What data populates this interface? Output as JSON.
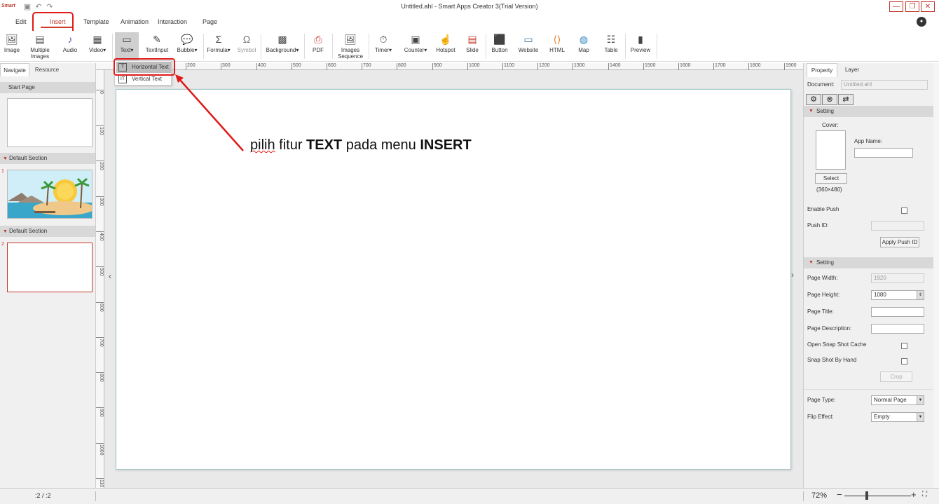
{
  "window": {
    "logo": "Smart",
    "title": "Untitled.ahl - Smart Apps Creator 3(Trial Version)",
    "minimize": "—",
    "maximize": "❐",
    "close": "✕"
  },
  "menu": {
    "tabs": [
      "Edit",
      "Insert",
      "Template",
      "Animation",
      "Interaction",
      "Page"
    ],
    "active": "Insert"
  },
  "ribbon": {
    "tools": [
      {
        "label": "Image",
        "icon": "image-icon"
      },
      {
        "label": "Multiple Images",
        "icon": "multiple-images-icon"
      },
      {
        "label": "Audio",
        "icon": "audio-icon"
      },
      {
        "label": "Video▾",
        "icon": "video-icon"
      },
      {
        "label": "Text▾",
        "icon": "text-icon"
      },
      {
        "label": "TextInput",
        "icon": "textinput-icon"
      },
      {
        "label": "Bubble▾",
        "icon": "bubble-icon"
      },
      {
        "label": "Formula▾",
        "icon": "formula-icon"
      },
      {
        "label": "Symbol",
        "icon": "symbol-icon"
      },
      {
        "label": "Background▾",
        "icon": "background-icon"
      },
      {
        "label": "PDF",
        "icon": "pdf-icon"
      },
      {
        "label": "Images Sequence",
        "icon": "images-sequence-icon"
      },
      {
        "label": "Timer▾",
        "icon": "timer-icon"
      },
      {
        "label": "Counter▾",
        "icon": "counter-icon"
      },
      {
        "label": "Hotspot",
        "icon": "hotspot-icon"
      },
      {
        "label": "Slide",
        "icon": "slide-icon"
      },
      {
        "label": "Button",
        "icon": "button-icon"
      },
      {
        "label": "Website",
        "icon": "website-icon"
      },
      {
        "label": "HTML",
        "icon": "html-icon"
      },
      {
        "label": "Map",
        "icon": "map-icon"
      },
      {
        "label": "Table",
        "icon": "table-icon"
      },
      {
        "label": "Preview",
        "icon": "preview-icon"
      }
    ],
    "text_dropdown": {
      "horizontal": "Horizontal Text",
      "vertical": "Vertical Text"
    }
  },
  "left_panel": {
    "tabs": [
      "Navigate",
      "Resource"
    ],
    "start_page": "Start Page",
    "sections": [
      {
        "title": "Default Section",
        "page_number": "1"
      },
      {
        "title": "Default Section",
        "page_number": "2"
      }
    ]
  },
  "ruler": {
    "top": [
      "200",
      "300",
      "400",
      "500",
      "600",
      "700",
      "800",
      "900",
      "1000",
      "1100",
      "1200",
      "1300",
      "1400",
      "1500",
      "1600",
      "1700",
      "1800",
      "1900"
    ],
    "left": [
      "0",
      "100",
      "200",
      "300",
      "400",
      "500",
      "600",
      "700",
      "800",
      "900",
      "1000",
      "110"
    ]
  },
  "annotation": {
    "part1": "pilih",
    "part2": " fitur ",
    "part3": "TEXT",
    "part4": " pada menu ",
    "part5": "INSERT"
  },
  "right_panel": {
    "tabs": [
      "Property",
      "Layer"
    ],
    "document_label": "Document:",
    "document_value": "Untitled.ahl",
    "section1": "Setting",
    "cover_label": "Cover:",
    "app_name_label": "App Name:",
    "select_button": "Select",
    "cover_size": "(360×480)",
    "enable_push": "Enable Push",
    "push_id": "Push ID:",
    "apply_push_id": "Apply Push ID",
    "section2": "Setting",
    "page_width_label": "Page Width:",
    "page_width": "1920",
    "page_height_label": "Page Height:",
    "page_height": "1080",
    "page_title_label": "Page Title:",
    "page_desc_label": "Page Description:",
    "snap_cache": "Open Snap Shot Cache",
    "snap_hand": "Snap Shot By Hand",
    "crop": "Crop",
    "page_type_label": "Page Type:",
    "page_type": "Normal Page",
    "flip_effect_label": "Flip Effect:",
    "flip_effect": "Empty"
  },
  "status": {
    "page_indicator": ":2  /  :2",
    "zoom": "72%",
    "zoom_fraction": 0.34
  },
  "colors": {
    "accent": "#d03a2a",
    "highlight_box": "#e01919"
  }
}
